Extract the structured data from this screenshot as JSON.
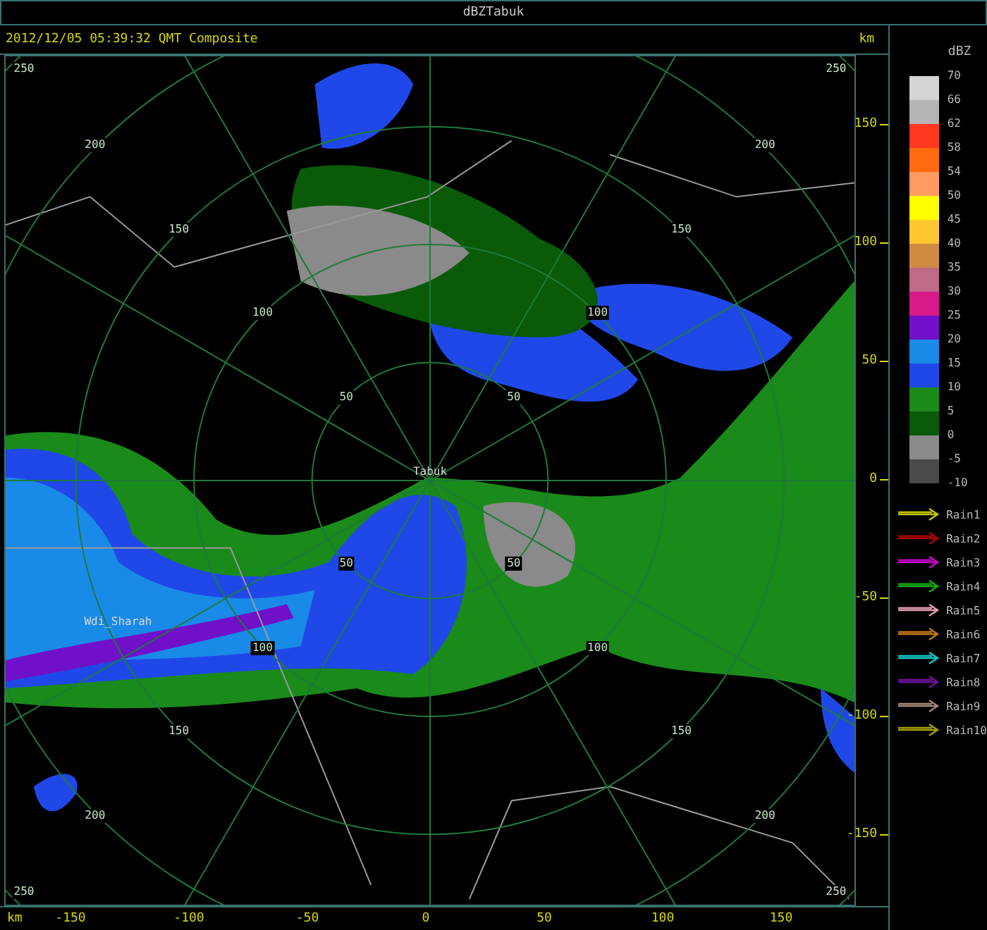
{
  "window": {
    "title": "dBZTabuk"
  },
  "header": {
    "timestamp": "2012/12/05 05:39:32 QMT Composite",
    "unit": "km"
  },
  "map": {
    "site_label": "Tabuk",
    "place_label": "Wdi_Sharah",
    "ring_labels": [
      "50",
      "100",
      "150",
      "200",
      "250",
      "50",
      "100",
      "150",
      "200",
      "250",
      "50",
      "100",
      "150",
      "200",
      "250",
      "50",
      "100",
      "150",
      "200",
      "250"
    ]
  },
  "x_axis": {
    "unit": "km",
    "ticks": [
      "-150",
      "-100",
      "-50",
      "0",
      "50",
      "100",
      "150"
    ]
  },
  "y_axis": {
    "ticks": [
      "150",
      "100",
      "50",
      "0",
      "-50",
      "-100",
      "-150"
    ]
  },
  "legend": {
    "title": "dBZ",
    "bins": [
      {
        "color": "#d4d4d4"
      },
      {
        "color": "#b4b4b4"
      },
      {
        "color": "#ff3820"
      },
      {
        "color": "#ff6a10"
      },
      {
        "color": "#ff9a60"
      },
      {
        "color": "#ffff00"
      },
      {
        "color": "#ffc830"
      },
      {
        "color": "#d08a40"
      },
      {
        "color": "#c06a8a"
      },
      {
        "color": "#d81a8a"
      },
      {
        "color": "#7010c8"
      },
      {
        "color": "#1a8ae8"
      },
      {
        "color": "#2048e8"
      },
      {
        "color": "#1a8a1a"
      },
      {
        "color": "#0a5a0a"
      },
      {
        "color": "#8a8a8a"
      },
      {
        "color": "#4a4a4a"
      }
    ],
    "labels": [
      "70",
      "66",
      "62",
      "58",
      "54",
      "50",
      "45",
      "40",
      "35",
      "30",
      "25",
      "20",
      "15",
      "10",
      "5",
      "0",
      "-5",
      "-10"
    ],
    "tracks": [
      {
        "label": "Rain1",
        "color": "#c8c800"
      },
      {
        "label": "Rain2",
        "color": "#b00000"
      },
      {
        "label": "Rain3",
        "color": "#d000d0"
      },
      {
        "label": "Rain4",
        "color": "#10b010"
      },
      {
        "label": "Rain5",
        "color": "#e8a0b0"
      },
      {
        "label": "Rain6",
        "color": "#c07810"
      },
      {
        "label": "Rain7",
        "color": "#10c8c8"
      },
      {
        "label": "Rain8",
        "color": "#7010a0"
      },
      {
        "label": "Rain9",
        "color": "#a08878"
      },
      {
        "label": "Rain10",
        "color": "#a0a000"
      }
    ]
  }
}
